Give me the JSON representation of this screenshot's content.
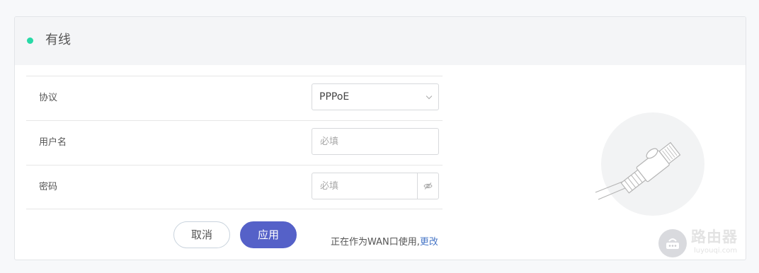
{
  "section": {
    "title": "有线",
    "status_color": "#27d9a6"
  },
  "form": {
    "protocol": {
      "label": "协议",
      "value": "PPPoE"
    },
    "username": {
      "label": "用户名",
      "placeholder": "必填",
      "value": ""
    },
    "password": {
      "label": "密码",
      "placeholder": "必填",
      "value": ""
    }
  },
  "actions": {
    "cancel_label": "取消",
    "apply_label": "应用",
    "apply_color": "#5561c8"
  },
  "wan_note": {
    "text": "正在作为WAN口使用,",
    "link": "更改"
  },
  "illustration": {
    "icon": "ethernet-cable-icon"
  },
  "watermark": {
    "title": "路由器",
    "subtitle": "luyouqi.com"
  }
}
